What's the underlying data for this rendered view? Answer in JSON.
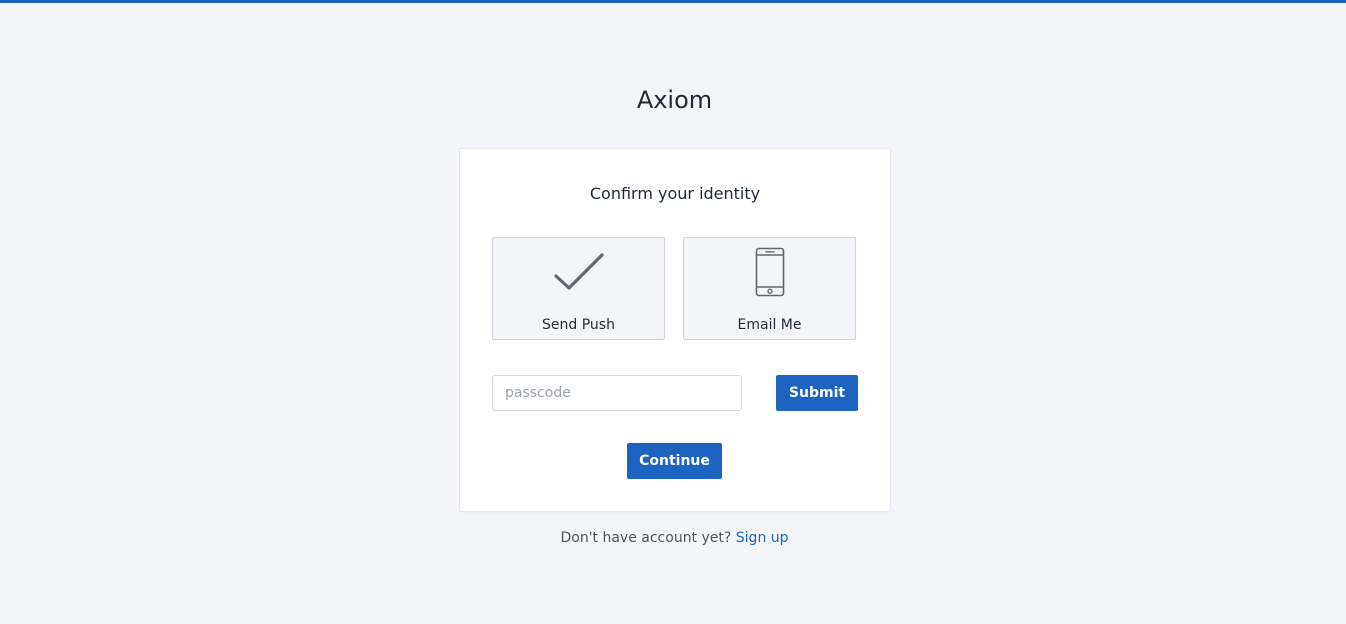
{
  "app": {
    "title": "Axiom",
    "accent_color": "#1d63c0"
  },
  "card": {
    "heading": "Confirm your identity",
    "methods": [
      {
        "label": "Send Push",
        "icon": "checkmark-icon"
      },
      {
        "label": "Email Me",
        "icon": "smartphone-icon"
      }
    ],
    "passcode": {
      "placeholder": "passcode",
      "value": ""
    },
    "submit_label": "Submit",
    "continue_label": "Continue"
  },
  "footer": {
    "prompt": "Don't have account yet?",
    "signup_link": "Sign up"
  }
}
